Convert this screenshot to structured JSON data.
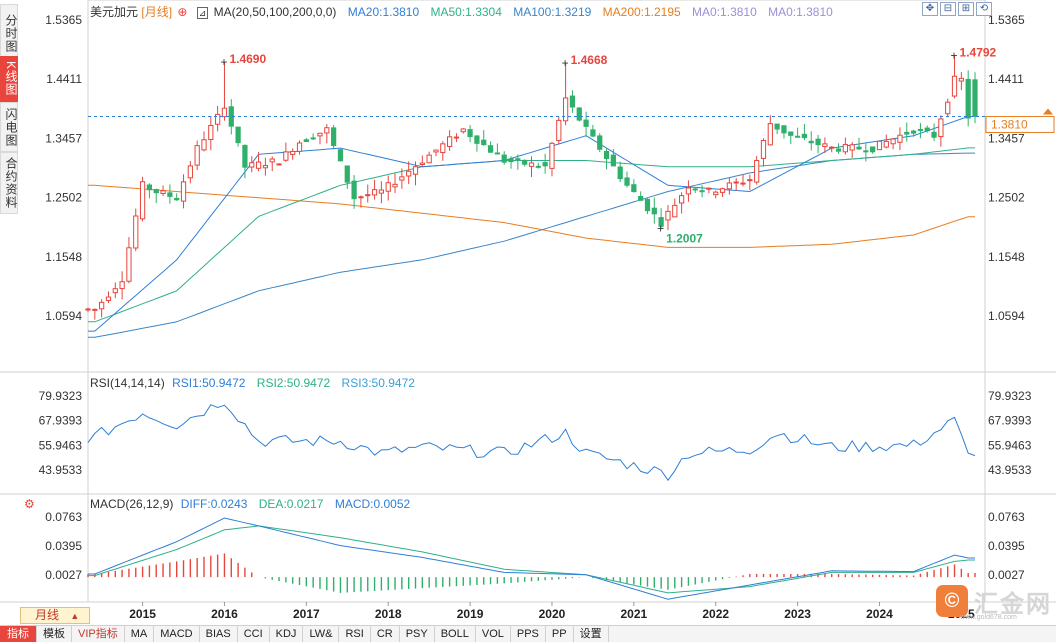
{
  "instrument": {
    "name": "美元加元",
    "period": "[月线]",
    "indicator_label": "MA(20,50,100,200,0,0)"
  },
  "side_tabs": [
    "分时图",
    "K线图",
    "闪电图",
    "合约资料"
  ],
  "ma_legend": [
    {
      "label": "MA20:1.3810",
      "color": "#2f7fd6"
    },
    {
      "label": "MA50:1.3304",
      "color": "#2fb08a"
    },
    {
      "label": "MA100:1.3219",
      "color": "#3a86c8"
    },
    {
      "label": "MA200:1.2195",
      "color": "#e67e22"
    },
    {
      "label": "MA0:1.3810",
      "color": "#9b8fd6"
    },
    {
      "label": "MA0:1.3810",
      "color": "#9b8fd6"
    }
  ],
  "price_axis": {
    "ticks": [
      "1.5365",
      "1.4411",
      "1.3457",
      "1.2502",
      "1.1548",
      "1.0594"
    ],
    "current": "1.3810"
  },
  "peak_labels": [
    {
      "text": "1.4690",
      "price": 1.469,
      "month": 1
    },
    {
      "text": "1.4668",
      "price": 1.4668,
      "month": 0
    },
    {
      "text": "1.4792",
      "price": 1.4792,
      "month": 12
    }
  ],
  "trough_label": {
    "text": "1.2007",
    "price": 1.2007
  },
  "year_labels": [
    "2015",
    "2016",
    "2017",
    "2018",
    "2019",
    "2020",
    "2021",
    "2022",
    "2023",
    "2024",
    "2025"
  ],
  "rsi": {
    "title": "RSI(14,14,14)",
    "values": [
      {
        "label": "RSI1:50.9472",
        "color": "#2f7fd6"
      },
      {
        "label": "RSI2:50.9472",
        "color": "#2fb08a"
      },
      {
        "label": "RSI3:50.9472",
        "color": "#3aa0d6"
      }
    ],
    "ticks": [
      "79.9323",
      "67.9393",
      "55.9463",
      "43.9533"
    ]
  },
  "macd": {
    "title": "MACD(26,12,9)",
    "values": [
      {
        "label": "DIFF:0.0243",
        "color": "#2f7fd6"
      },
      {
        "label": "DEA:0.0217",
        "color": "#2fb08a"
      },
      {
        "label": "MACD:0.0052",
        "color": "#2f7fd6"
      }
    ],
    "ticks": [
      "0.0763",
      "0.0395",
      "0.0027"
    ]
  },
  "period_selector": "月线",
  "bottom_tabs": [
    "指标",
    "模板",
    "VIP指标",
    "MA",
    "MACD",
    "BIAS",
    "CCI",
    "KDJ",
    "LW&",
    "RSI",
    "CR",
    "PSY",
    "BOLL",
    "VOL",
    "PPS",
    "PP",
    "设置"
  ],
  "logo": {
    "text": "汇金网",
    "sub": "www.gold678.com"
  },
  "chart_data": {
    "type": "candlestick",
    "title": "美元加元 [月线]",
    "x_range": [
      "2014-05",
      "2025-02"
    ],
    "y_range": [
      1.01,
      1.545
    ],
    "price_levels": {
      "ath_2016": 1.469,
      "high_2020": 1.4668,
      "high_2025": 1.4792,
      "low_2021": 1.2007,
      "current": 1.381
    },
    "close_path": [
      [
        "2014-06",
        1.07
      ],
      [
        "2014-10",
        1.12
      ],
      [
        "2015-01",
        1.27
      ],
      [
        "2015-03",
        1.26
      ],
      [
        "2015-06",
        1.25
      ],
      [
        "2015-09",
        1.33
      ],
      [
        "2015-12",
        1.38
      ],
      [
        "2016-01",
        1.4
      ],
      [
        "2016-04",
        1.3
      ],
      [
        "2016-09",
        1.31
      ],
      [
        "2016-12",
        1.34
      ],
      [
        "2017-04",
        1.36
      ],
      [
        "2017-08",
        1.25
      ],
      [
        "2017-12",
        1.26
      ],
      [
        "2018-06",
        1.31
      ],
      [
        "2018-12",
        1.36
      ],
      [
        "2019-06",
        1.31
      ],
      [
        "2019-12",
        1.3
      ],
      [
        "2020-03",
        1.41
      ],
      [
        "2020-06",
        1.36
      ],
      [
        "2020-12",
        1.27
      ],
      [
        "2021-05",
        1.21
      ],
      [
        "2021-09",
        1.27
      ],
      [
        "2021-12",
        1.26
      ],
      [
        "2022-06",
        1.28
      ],
      [
        "2022-09",
        1.37
      ],
      [
        "2022-12",
        1.35
      ],
      [
        "2023-06",
        1.33
      ],
      [
        "2023-12",
        1.33
      ],
      [
        "2024-06",
        1.36
      ],
      [
        "2024-09",
        1.35
      ],
      [
        "2024-12",
        1.44
      ],
      [
        "2025-01",
        1.44
      ],
      [
        "2025-02",
        1.381
      ]
    ],
    "ma20_path": [
      [
        "2014-06",
        1.035
      ],
      [
        "2015-06",
        1.15
      ],
      [
        "2016-06",
        1.32
      ],
      [
        "2017-06",
        1.33
      ],
      [
        "2018-06",
        1.3
      ],
      [
        "2019-06",
        1.31
      ],
      [
        "2020-06",
        1.35
      ],
      [
        "2021-06",
        1.27
      ],
      [
        "2022-06",
        1.26
      ],
      [
        "2023-06",
        1.33
      ],
      [
        "2024-06",
        1.35
      ],
      [
        "2025-02",
        1.381
      ]
    ],
    "ma50_path": [
      [
        "2014-06",
        1.05
      ],
      [
        "2015-06",
        1.1
      ],
      [
        "2016-06",
        1.22
      ],
      [
        "2017-06",
        1.27
      ],
      [
        "2018-06",
        1.3
      ],
      [
        "2019-06",
        1.31
      ],
      [
        "2020-06",
        1.31
      ],
      [
        "2021-06",
        1.3
      ],
      [
        "2022-06",
        1.3
      ],
      [
        "2023-06",
        1.31
      ],
      [
        "2024-06",
        1.32
      ],
      [
        "2025-02",
        1.3304
      ]
    ],
    "ma100_path": [
      [
        "2014-06",
        1.025
      ],
      [
        "2015-06",
        1.05
      ],
      [
        "2016-06",
        1.1
      ],
      [
        "2017-06",
        1.13
      ],
      [
        "2018-06",
        1.15
      ],
      [
        "2019-06",
        1.18
      ],
      [
        "2020-06",
        1.22
      ],
      [
        "2021-06",
        1.26
      ],
      [
        "2022-06",
        1.29
      ],
      [
        "2023-06",
        1.31
      ],
      [
        "2024-06",
        1.32
      ],
      [
        "2025-02",
        1.3219
      ]
    ],
    "ma200_path": [
      [
        "2014-06",
        1.27
      ],
      [
        "2015-06",
        1.26
      ],
      [
        "2016-06",
        1.25
      ],
      [
        "2017-06",
        1.24
      ],
      [
        "2018-06",
        1.225
      ],
      [
        "2019-06",
        1.21
      ],
      [
        "2020-06",
        1.185
      ],
      [
        "2021-06",
        1.17
      ],
      [
        "2022-06",
        1.17
      ],
      [
        "2023-06",
        1.175
      ],
      [
        "2024-06",
        1.19
      ],
      [
        "2025-02",
        1.2195
      ]
    ],
    "rsi_path": [
      [
        "2014-06",
        60
      ],
      [
        "2015-01",
        72
      ],
      [
        "2015-06",
        66
      ],
      [
        "2016-01",
        78
      ],
      [
        "2016-06",
        58
      ],
      [
        "2017-06",
        58
      ],
      [
        "2017-12",
        52
      ],
      [
        "2018-06",
        55
      ],
      [
        "2019-06",
        52
      ],
      [
        "2020-03",
        62
      ],
      [
        "2020-06",
        52
      ],
      [
        "2021-06",
        42
      ],
      [
        "2021-09",
        52
      ],
      [
        "2022-06",
        54
      ],
      [
        "2022-10",
        62
      ],
      [
        "2023-06",
        55
      ],
      [
        "2024-06",
        56
      ],
      [
        "2024-12",
        68
      ],
      [
        "2025-02",
        50.9472
      ]
    ],
    "diff_path": [
      [
        "2014-06",
        0.004
      ],
      [
        "2015-06",
        0.045
      ],
      [
        "2016-01",
        0.075
      ],
      [
        "2016-06",
        0.065
      ],
      [
        "2017-06",
        0.04
      ],
      [
        "2018-06",
        0.025
      ],
      [
        "2019-06",
        0.006
      ],
      [
        "2020-06",
        0.003
      ],
      [
        "2021-06",
        -0.028
      ],
      [
        "2022-06",
        -0.01
      ],
      [
        "2023-06",
        0.008
      ],
      [
        "2024-06",
        0.007
      ],
      [
        "2024-12",
        0.028
      ],
      [
        "2025-02",
        0.0243
      ]
    ],
    "dea_path": [
      [
        "2014-06",
        0.002
      ],
      [
        "2015-06",
        0.035
      ],
      [
        "2016-01",
        0.06
      ],
      [
        "2016-06",
        0.065
      ],
      [
        "2017-06",
        0.05
      ],
      [
        "2018-06",
        0.032
      ],
      [
        "2019-06",
        0.01
      ],
      [
        "2020-06",
        0.003
      ],
      [
        "2021-06",
        -0.02
      ],
      [
        "2022-06",
        -0.012
      ],
      [
        "2023-06",
        0.006
      ],
      [
        "2024-06",
        0.006
      ],
      [
        "2024-12",
        0.02
      ],
      [
        "2025-02",
        0.0217
      ]
    ]
  }
}
